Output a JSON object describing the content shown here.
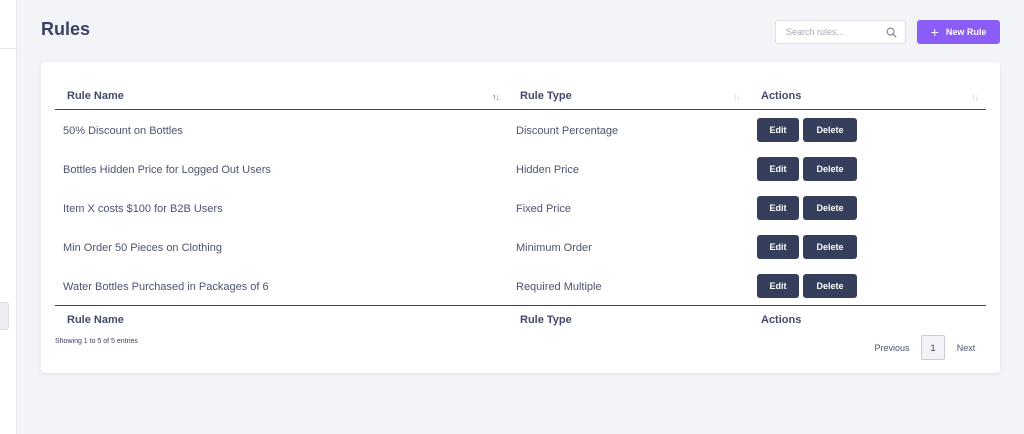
{
  "page": {
    "title": "Rules"
  },
  "search": {
    "placeholder": "Search rules..."
  },
  "toolbar": {
    "new_rule_label": "New Rule",
    "plus_glyph": "+"
  },
  "table": {
    "columns": [
      "Rule Name",
      "Rule Type",
      "Actions"
    ],
    "footer_columns": [
      "Rule Name",
      "Rule Type",
      "Actions"
    ],
    "rows": [
      {
        "name": "50% Discount on Bottles",
        "type": "Discount Percentage",
        "edit": "Edit",
        "delete": "Delete"
      },
      {
        "name": "Bottles Hidden Price for Logged Out Users",
        "type": "Hidden Price",
        "edit": "Edit",
        "delete": "Delete"
      },
      {
        "name": "Item X costs $100 for B2B Users",
        "type": "Fixed Price",
        "edit": "Edit",
        "delete": "Delete"
      },
      {
        "name": "Min Order 50 Pieces on Clothing",
        "type": "Minimum Order",
        "edit": "Edit",
        "delete": "Delete"
      },
      {
        "name": "Water Bottles Purchased in Packages of 6",
        "type": "Required Multiple",
        "edit": "Edit",
        "delete": "Delete"
      }
    ],
    "sort": {
      "column": "Rule Name",
      "direction": "asc"
    }
  },
  "footer": {
    "entries_info": "Showing 1 to 5 of 5 entries",
    "pagination": {
      "previous": "Previous",
      "current_page": "1",
      "next": "Next"
    }
  },
  "icons": {
    "search": "search-icon",
    "plus": "plus-icon",
    "sort": "sort-arrows-icon"
  },
  "colors": {
    "accent": "#8b5cf6",
    "button_dark": "#353f5b",
    "title": "#3b4266",
    "background": "#f3f4f8"
  }
}
